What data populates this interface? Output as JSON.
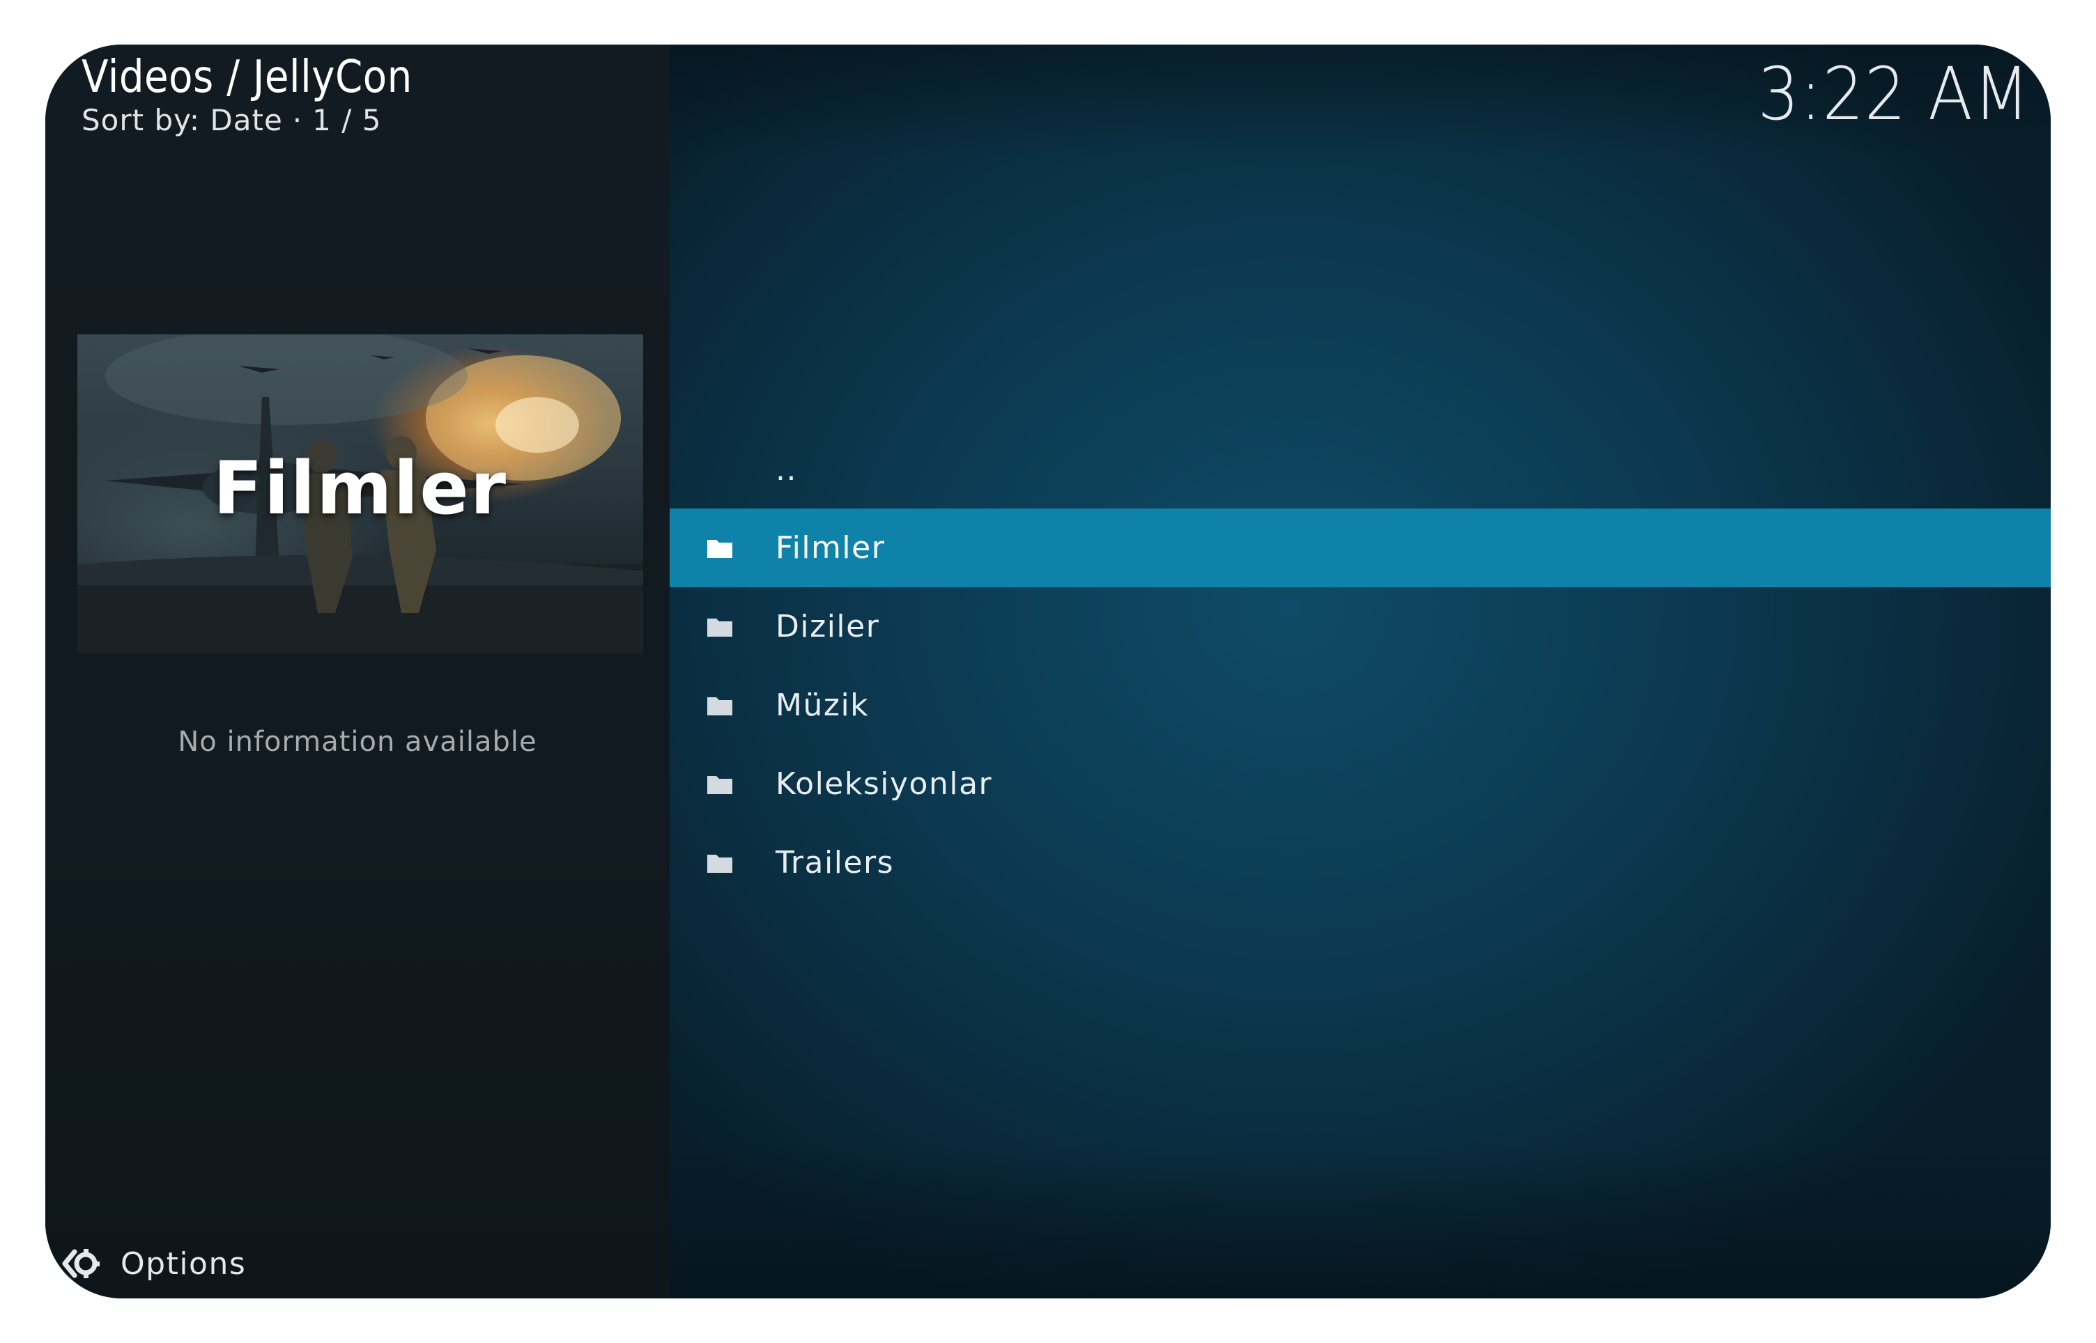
{
  "header": {
    "title": "Videos / JellyCon",
    "sort_label": "Sort by: Date",
    "separator": "·",
    "position": "1 / 5"
  },
  "clock": "3:22 AM",
  "info_panel": {
    "poster_title": "Filmler",
    "no_info_text": "No information available"
  },
  "footer": {
    "options_label": "Options",
    "options_icon": "gear-back-icon"
  },
  "file_list": {
    "parent_label": "..",
    "items": [
      {
        "label": "Filmler",
        "icon": "folder-icon",
        "selected": true
      },
      {
        "label": "Diziler",
        "icon": "folder-icon",
        "selected": false
      },
      {
        "label": "Müzik",
        "icon": "folder-icon",
        "selected": false
      },
      {
        "label": "Koleksiyonlar",
        "icon": "folder-icon",
        "selected": false
      },
      {
        "label": "Trailers",
        "icon": "folder-icon",
        "selected": false
      }
    ]
  },
  "colors": {
    "selection": "#0f82a9",
    "side_panel": "#121b21",
    "main_background": "#0c3a52"
  }
}
